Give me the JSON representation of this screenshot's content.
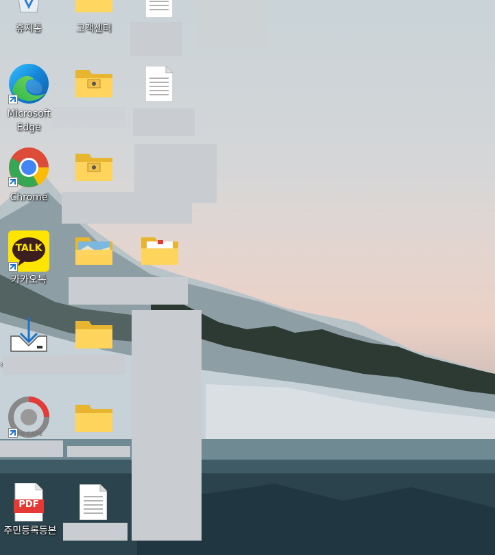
{
  "desktop": {
    "icons": [
      {
        "label": "휴지통"
      },
      {
        "label": "고객센터"
      },
      {
        "label": "Microsoft Edge"
      },
      {
        "label": "Chrome"
      },
      {
        "label": "카카오톡"
      },
      {
        "label": "주민등록등본"
      }
    ],
    "icon_badges": {
      "kakaotalk": "TALK",
      "pdf": "PDF",
      "captureapp": "TO CAPE"
    },
    "colors": {
      "folder": "#f5c842",
      "kakao_yellow": "#fee500",
      "kakao_brown": "#3c1e1e",
      "pdf_red": "#e53935",
      "redaction_gray": "#c9ccd0"
    }
  }
}
